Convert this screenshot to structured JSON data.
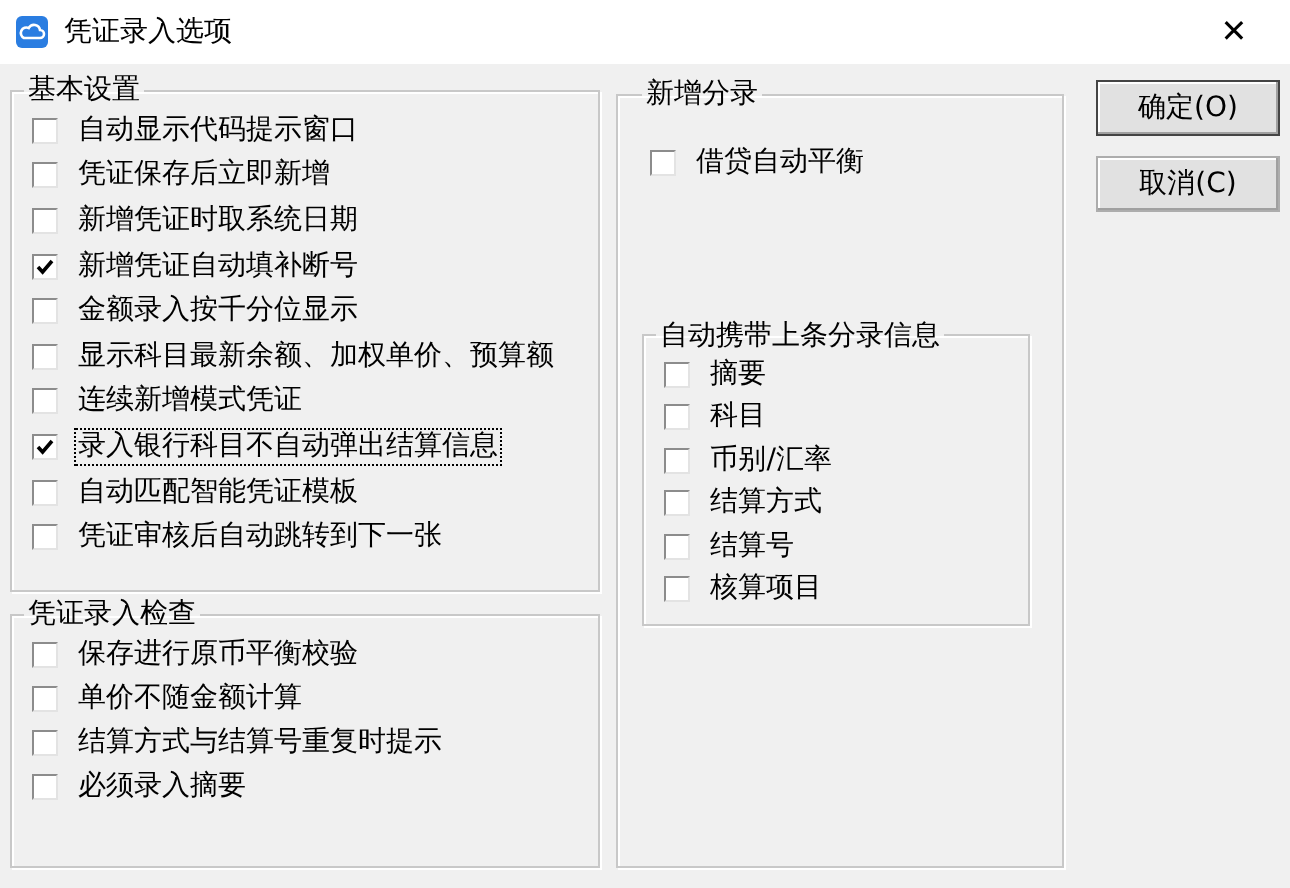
{
  "window": {
    "title": "凭证录入选项",
    "close": "✕"
  },
  "basic_settings": {
    "title": "基本设置",
    "options": [
      {
        "label": "自动显示代码提示窗口",
        "checked": false,
        "focused": false
      },
      {
        "label": "凭证保存后立即新增",
        "checked": false,
        "focused": false
      },
      {
        "label": "新增凭证时取系统日期",
        "checked": false,
        "focused": false
      },
      {
        "label": "新增凭证自动填补断号",
        "checked": true,
        "focused": false
      },
      {
        "label": "金额录入按千分位显示",
        "checked": false,
        "focused": false
      },
      {
        "label": "显示科目最新余额、加权单价、预算额",
        "checked": false,
        "focused": false
      },
      {
        "label": "连续新增模式凭证",
        "checked": false,
        "focused": false
      },
      {
        "label": "录入银行科目不自动弹出结算信息",
        "checked": true,
        "focused": true
      },
      {
        "label": "自动匹配智能凭证模板",
        "checked": false,
        "focused": false
      },
      {
        "label": "凭证审核后自动跳转到下一张",
        "checked": false,
        "focused": false
      }
    ]
  },
  "entry_check": {
    "title": "凭证录入检查",
    "options": [
      {
        "label": "保存进行原币平衡校验",
        "checked": false
      },
      {
        "label": "单价不随金额计算",
        "checked": false
      },
      {
        "label": "结算方式与结算号重复时提示",
        "checked": false
      },
      {
        "label": "必须录入摘要",
        "checked": false
      }
    ]
  },
  "new_entry": {
    "title": "新增分录",
    "options": [
      {
        "label": "借贷自动平衡",
        "checked": false
      }
    ],
    "carry_over": {
      "title": "自动携带上条分录信息",
      "options": [
        {
          "label": "摘要",
          "checked": false
        },
        {
          "label": "科目",
          "checked": false
        },
        {
          "label": "币别/汇率",
          "checked": false
        },
        {
          "label": "结算方式",
          "checked": false
        },
        {
          "label": "结算号",
          "checked": false
        },
        {
          "label": "核算项目",
          "checked": false
        }
      ]
    }
  },
  "buttons": [
    {
      "label": "确定(O)",
      "default": true
    },
    {
      "label": "取消(C)",
      "default": false
    }
  ]
}
